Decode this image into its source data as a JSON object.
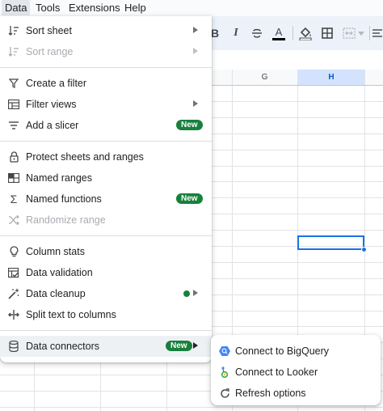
{
  "menubar": {
    "items": [
      "Data",
      "Tools",
      "Extensions",
      "Help"
    ],
    "active": "Data"
  },
  "toolbar": {
    "icons": [
      "bold-icon",
      "italic-icon",
      "strikethrough-icon",
      "text-color-icon",
      "fill-color-icon",
      "borders-icon",
      "merge-cells-icon",
      "chevron-down-icon",
      "align-icon"
    ],
    "bold_label": "B",
    "italic_label": "I",
    "text_color_label": "A"
  },
  "grid": {
    "columns": [
      "G",
      "H"
    ],
    "selected_column": "H"
  },
  "data_menu": {
    "items": [
      {
        "label": "Sort sheet",
        "icon": "sort-icon",
        "submenu": true,
        "disabled": false
      },
      {
        "label": "Sort range",
        "icon": "sort-icon",
        "submenu": true,
        "disabled": true
      },
      {
        "label": "Create a filter",
        "icon": "filter-icon",
        "submenu": false,
        "disabled": false
      },
      {
        "label": "Filter views",
        "icon": "filter-views-icon",
        "submenu": true,
        "disabled": false
      },
      {
        "label": "Add a slicer",
        "icon": "slicer-icon",
        "badge": "New",
        "disabled": false
      },
      {
        "label": "Protect sheets and ranges",
        "icon": "lock-icon",
        "disabled": false
      },
      {
        "label": "Named ranges",
        "icon": "named-ranges-icon",
        "disabled": false
      },
      {
        "label": "Named functions",
        "icon": "sigma-icon",
        "badge": "New",
        "disabled": false
      },
      {
        "label": "Randomize range",
        "icon": "shuffle-icon",
        "disabled": true
      },
      {
        "label": "Column stats",
        "icon": "lightbulb-icon",
        "disabled": false
      },
      {
        "label": "Data validation",
        "icon": "data-validation-icon",
        "disabled": false
      },
      {
        "label": "Data cleanup",
        "icon": "magic-wand-icon",
        "submenu": true,
        "dot": true,
        "disabled": false
      },
      {
        "label": "Split text to columns",
        "icon": "split-columns-icon",
        "disabled": false
      },
      {
        "label": "Data connectors",
        "icon": "database-icon",
        "badge": "New",
        "submenu": true,
        "disabled": false,
        "highlighted": true
      }
    ]
  },
  "submenu": {
    "items": [
      {
        "label": "Connect to BigQuery",
        "icon": "bigquery-icon"
      },
      {
        "label": "Connect to Looker",
        "icon": "looker-icon"
      },
      {
        "label": "Refresh options",
        "icon": "refresh-icon"
      }
    ]
  },
  "colors": {
    "accent": "#1a73e8",
    "badge": "#18803c",
    "toolbar_bg": "#edf2fa",
    "menubar_bg": "#f9fbfd",
    "hover_bg": "#eef1f4",
    "selected_header_bg": "#d3e3fd"
  }
}
